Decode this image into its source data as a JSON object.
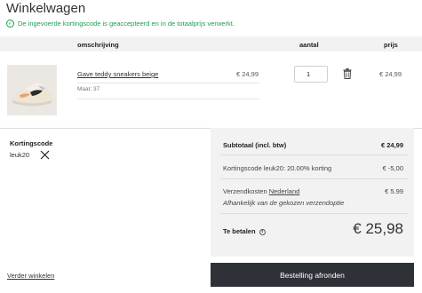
{
  "page": {
    "title": "Winkelwagen"
  },
  "notice": {
    "text": "De ingevoerde kortingscode is geaccepteerd en in de totaalprijs verwerkt."
  },
  "table": {
    "headers": {
      "description": "omschrijving",
      "quantity": "aantal",
      "price": "prijs"
    }
  },
  "items": [
    {
      "name": "Gave teddy sneakers beige",
      "size": "Maat: 37",
      "unit_price": "€ 24,99",
      "quantity": "1",
      "total": "€ 24,99"
    }
  ],
  "coupon": {
    "title": "Kortingscode",
    "code": "leuk20"
  },
  "summary": {
    "subtotal_label": "Subtotaal (incl. btw)",
    "subtotal_value": "€ 24,99",
    "discount_label": "Kortingscode leuk20: 20.00% korting",
    "discount_value": "€ -5,00",
    "shipping_label": "Verzendkosten",
    "shipping_country": "Nederland",
    "shipping_value": "€ 5.99",
    "shipping_note": "Afhankelijk van de gekozen verzendoptie",
    "total_label": "Te betalen",
    "total_value": "€ 25,98"
  },
  "actions": {
    "continue": "Verder winkelen",
    "checkout": "Bestelling afronden"
  },
  "colors": {
    "success": "#1e9e4a",
    "button": "#2e3238",
    "panel": "#f2f2f2"
  }
}
